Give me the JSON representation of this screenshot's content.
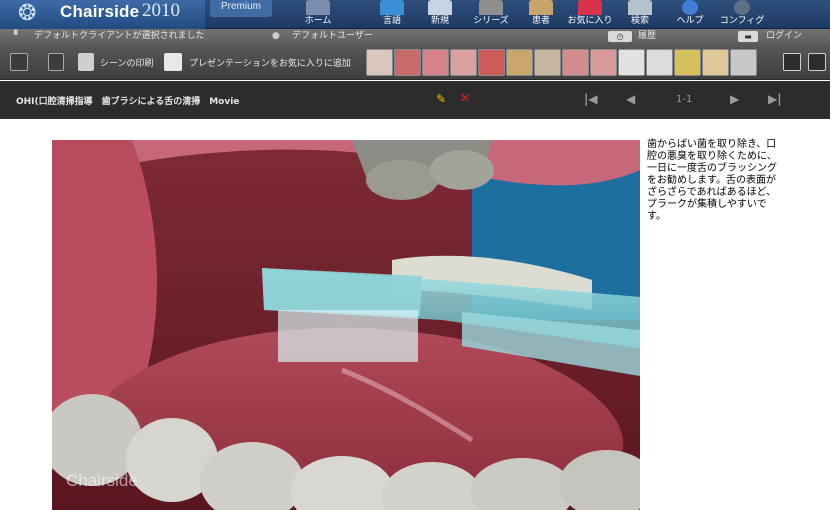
{
  "header": {
    "brand_name": "Chairside",
    "brand_year": "2010",
    "edition": "Premium",
    "nav": [
      {
        "label": "ホーム",
        "icon": "home-icon"
      },
      {
        "label": "言語",
        "icon": "language-icon"
      },
      {
        "label": "新規",
        "icon": "new-icon"
      },
      {
        "label": "シリーズ",
        "icon": "series-icon"
      },
      {
        "label": "患者",
        "icon": "patient-icon"
      },
      {
        "label": "お気に入り",
        "icon": "favorites-icon"
      },
      {
        "label": "検索",
        "icon": "search-icon"
      },
      {
        "label": "ヘルプ",
        "icon": "help-icon"
      },
      {
        "label": "コンフィグ",
        "icon": "config-icon"
      }
    ]
  },
  "status": {
    "client": "デフォルトクライアントが選択されました",
    "user": "デフォルトユーザー",
    "history": "履歴",
    "login": "ログイン"
  },
  "toolbar": {
    "print_scene": "シーンの印刷",
    "add_favorite": "プレゼンテーションをお気に入りに追加"
  },
  "scene": {
    "title": "OHI(口腔清掃指導　歯ブラシによる舌の清掃　Movie",
    "page": "1-1",
    "watermark": "Chairside",
    "description": "歯からばい菌を取り除き、口腔の悪臭を取り除くために、一日に一度舌のブラッシングをお勧めします。舌の表面がざらざらであればあるほど、プラークが集積しやすいです。"
  },
  "colors": {
    "header_bg": "#1d3a63",
    "toolbar_bg": "#4a4a4a",
    "scenebar_bg": "#2c2c2c",
    "accent_edit": "#f2c200",
    "accent_close": "#e02020"
  }
}
